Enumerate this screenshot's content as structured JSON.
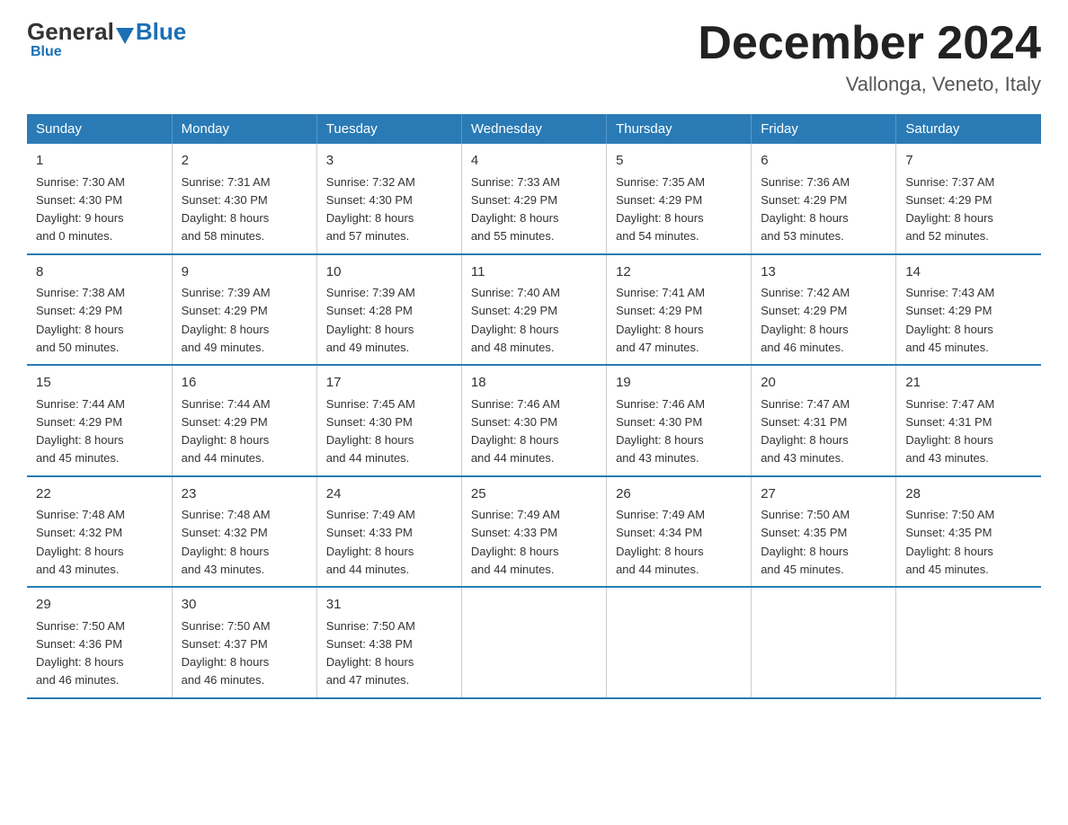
{
  "logo": {
    "general": "General",
    "blue": "Blue",
    "tagline": "Blue"
  },
  "header": {
    "title": "December 2024",
    "subtitle": "Vallonga, Veneto, Italy"
  },
  "days_of_week": [
    "Sunday",
    "Monday",
    "Tuesday",
    "Wednesday",
    "Thursday",
    "Friday",
    "Saturday"
  ],
  "weeks": [
    {
      "days": [
        {
          "number": "1",
          "sunrise": "Sunrise: 7:30 AM",
          "sunset": "Sunset: 4:30 PM",
          "daylight": "Daylight: 9 hours",
          "daylight2": "and 0 minutes."
        },
        {
          "number": "2",
          "sunrise": "Sunrise: 7:31 AM",
          "sunset": "Sunset: 4:30 PM",
          "daylight": "Daylight: 8 hours",
          "daylight2": "and 58 minutes."
        },
        {
          "number": "3",
          "sunrise": "Sunrise: 7:32 AM",
          "sunset": "Sunset: 4:30 PM",
          "daylight": "Daylight: 8 hours",
          "daylight2": "and 57 minutes."
        },
        {
          "number": "4",
          "sunrise": "Sunrise: 7:33 AM",
          "sunset": "Sunset: 4:29 PM",
          "daylight": "Daylight: 8 hours",
          "daylight2": "and 55 minutes."
        },
        {
          "number": "5",
          "sunrise": "Sunrise: 7:35 AM",
          "sunset": "Sunset: 4:29 PM",
          "daylight": "Daylight: 8 hours",
          "daylight2": "and 54 minutes."
        },
        {
          "number": "6",
          "sunrise": "Sunrise: 7:36 AM",
          "sunset": "Sunset: 4:29 PM",
          "daylight": "Daylight: 8 hours",
          "daylight2": "and 53 minutes."
        },
        {
          "number": "7",
          "sunrise": "Sunrise: 7:37 AM",
          "sunset": "Sunset: 4:29 PM",
          "daylight": "Daylight: 8 hours",
          "daylight2": "and 52 minutes."
        }
      ]
    },
    {
      "days": [
        {
          "number": "8",
          "sunrise": "Sunrise: 7:38 AM",
          "sunset": "Sunset: 4:29 PM",
          "daylight": "Daylight: 8 hours",
          "daylight2": "and 50 minutes."
        },
        {
          "number": "9",
          "sunrise": "Sunrise: 7:39 AM",
          "sunset": "Sunset: 4:29 PM",
          "daylight": "Daylight: 8 hours",
          "daylight2": "and 49 minutes."
        },
        {
          "number": "10",
          "sunrise": "Sunrise: 7:39 AM",
          "sunset": "Sunset: 4:28 PM",
          "daylight": "Daylight: 8 hours",
          "daylight2": "and 49 minutes."
        },
        {
          "number": "11",
          "sunrise": "Sunrise: 7:40 AM",
          "sunset": "Sunset: 4:29 PM",
          "daylight": "Daylight: 8 hours",
          "daylight2": "and 48 minutes."
        },
        {
          "number": "12",
          "sunrise": "Sunrise: 7:41 AM",
          "sunset": "Sunset: 4:29 PM",
          "daylight": "Daylight: 8 hours",
          "daylight2": "and 47 minutes."
        },
        {
          "number": "13",
          "sunrise": "Sunrise: 7:42 AM",
          "sunset": "Sunset: 4:29 PM",
          "daylight": "Daylight: 8 hours",
          "daylight2": "and 46 minutes."
        },
        {
          "number": "14",
          "sunrise": "Sunrise: 7:43 AM",
          "sunset": "Sunset: 4:29 PM",
          "daylight": "Daylight: 8 hours",
          "daylight2": "and 45 minutes."
        }
      ]
    },
    {
      "days": [
        {
          "number": "15",
          "sunrise": "Sunrise: 7:44 AM",
          "sunset": "Sunset: 4:29 PM",
          "daylight": "Daylight: 8 hours",
          "daylight2": "and 45 minutes."
        },
        {
          "number": "16",
          "sunrise": "Sunrise: 7:44 AM",
          "sunset": "Sunset: 4:29 PM",
          "daylight": "Daylight: 8 hours",
          "daylight2": "and 44 minutes."
        },
        {
          "number": "17",
          "sunrise": "Sunrise: 7:45 AM",
          "sunset": "Sunset: 4:30 PM",
          "daylight": "Daylight: 8 hours",
          "daylight2": "and 44 minutes."
        },
        {
          "number": "18",
          "sunrise": "Sunrise: 7:46 AM",
          "sunset": "Sunset: 4:30 PM",
          "daylight": "Daylight: 8 hours",
          "daylight2": "and 44 minutes."
        },
        {
          "number": "19",
          "sunrise": "Sunrise: 7:46 AM",
          "sunset": "Sunset: 4:30 PM",
          "daylight": "Daylight: 8 hours",
          "daylight2": "and 43 minutes."
        },
        {
          "number": "20",
          "sunrise": "Sunrise: 7:47 AM",
          "sunset": "Sunset: 4:31 PM",
          "daylight": "Daylight: 8 hours",
          "daylight2": "and 43 minutes."
        },
        {
          "number": "21",
          "sunrise": "Sunrise: 7:47 AM",
          "sunset": "Sunset: 4:31 PM",
          "daylight": "Daylight: 8 hours",
          "daylight2": "and 43 minutes."
        }
      ]
    },
    {
      "days": [
        {
          "number": "22",
          "sunrise": "Sunrise: 7:48 AM",
          "sunset": "Sunset: 4:32 PM",
          "daylight": "Daylight: 8 hours",
          "daylight2": "and 43 minutes."
        },
        {
          "number": "23",
          "sunrise": "Sunrise: 7:48 AM",
          "sunset": "Sunset: 4:32 PM",
          "daylight": "Daylight: 8 hours",
          "daylight2": "and 43 minutes."
        },
        {
          "number": "24",
          "sunrise": "Sunrise: 7:49 AM",
          "sunset": "Sunset: 4:33 PM",
          "daylight": "Daylight: 8 hours",
          "daylight2": "and 44 minutes."
        },
        {
          "number": "25",
          "sunrise": "Sunrise: 7:49 AM",
          "sunset": "Sunset: 4:33 PM",
          "daylight": "Daylight: 8 hours",
          "daylight2": "and 44 minutes."
        },
        {
          "number": "26",
          "sunrise": "Sunrise: 7:49 AM",
          "sunset": "Sunset: 4:34 PM",
          "daylight": "Daylight: 8 hours",
          "daylight2": "and 44 minutes."
        },
        {
          "number": "27",
          "sunrise": "Sunrise: 7:50 AM",
          "sunset": "Sunset: 4:35 PM",
          "daylight": "Daylight: 8 hours",
          "daylight2": "and 45 minutes."
        },
        {
          "number": "28",
          "sunrise": "Sunrise: 7:50 AM",
          "sunset": "Sunset: 4:35 PM",
          "daylight": "Daylight: 8 hours",
          "daylight2": "and 45 minutes."
        }
      ]
    },
    {
      "days": [
        {
          "number": "29",
          "sunrise": "Sunrise: 7:50 AM",
          "sunset": "Sunset: 4:36 PM",
          "daylight": "Daylight: 8 hours",
          "daylight2": "and 46 minutes."
        },
        {
          "number": "30",
          "sunrise": "Sunrise: 7:50 AM",
          "sunset": "Sunset: 4:37 PM",
          "daylight": "Daylight: 8 hours",
          "daylight2": "and 46 minutes."
        },
        {
          "number": "31",
          "sunrise": "Sunrise: 7:50 AM",
          "sunset": "Sunset: 4:38 PM",
          "daylight": "Daylight: 8 hours",
          "daylight2": "and 47 minutes."
        },
        {
          "number": "",
          "sunrise": "",
          "sunset": "",
          "daylight": "",
          "daylight2": ""
        },
        {
          "number": "",
          "sunrise": "",
          "sunset": "",
          "daylight": "",
          "daylight2": ""
        },
        {
          "number": "",
          "sunrise": "",
          "sunset": "",
          "daylight": "",
          "daylight2": ""
        },
        {
          "number": "",
          "sunrise": "",
          "sunset": "",
          "daylight": "",
          "daylight2": ""
        }
      ]
    }
  ]
}
